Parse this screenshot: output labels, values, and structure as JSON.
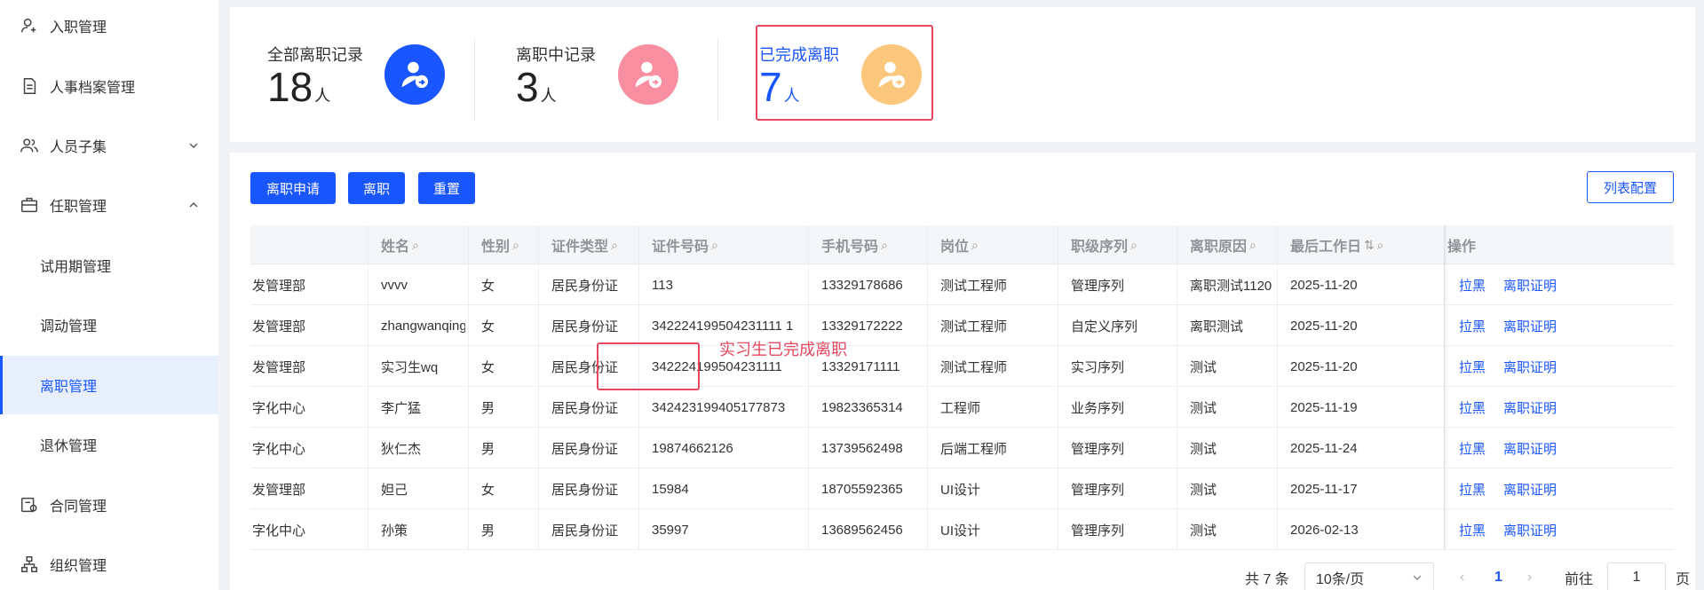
{
  "sidebar": {
    "items": [
      {
        "label": "入职管理",
        "icon": "user-add-icon"
      },
      {
        "label": "人事档案管理",
        "icon": "document-icon"
      },
      {
        "label": "人员子集",
        "icon": "users-icon"
      },
      {
        "label": "任职管理",
        "icon": "briefcase-icon"
      }
    ],
    "sub_items": [
      {
        "label": "试用期管理"
      },
      {
        "label": "调动管理"
      },
      {
        "label": "离职管理",
        "active": true
      },
      {
        "label": "退休管理"
      }
    ],
    "bottom_items": [
      {
        "label": "合同管理",
        "icon": "contract-icon"
      },
      {
        "label": "组织管理",
        "icon": "org-chart-icon"
      }
    ]
  },
  "stats": [
    {
      "title": "全部离职记录",
      "value": "18",
      "unit": "人",
      "color": "#1a56ff"
    },
    {
      "title": "离职中记录",
      "value": "3",
      "unit": "人",
      "color": "#f78fa0"
    },
    {
      "title": "已完成离职",
      "value": "7",
      "unit": "人",
      "color": "#fbc77c"
    }
  ],
  "toolbar": {
    "apply": "离职申请",
    "resign": "离职",
    "reset": "重置",
    "config": "列表配置"
  },
  "table": {
    "headers": [
      "姓名",
      "性别",
      "证件类型",
      "证件号码",
      "手机号码",
      "岗位",
      "职级序列",
      "离职原因",
      "最后工作日",
      "操作"
    ],
    "rows": [
      {
        "dept": "发管理部",
        "name": "vvvv",
        "gender": "女",
        "idtype": "居民身份证",
        "idno": "113",
        "phone": "13329178686",
        "post": "测试工程师",
        "rank": "管理序列",
        "reason": "离职测试1120",
        "lastday": "2025-11-20"
      },
      {
        "dept": "发管理部",
        "name": "zhangwanqing",
        "gender": "女",
        "idtype": "居民身份证",
        "idno": "342224199504231111 1",
        "phone": "13329172222",
        "post": "测试工程师",
        "rank": "自定义序列",
        "reason": "离职测试",
        "lastday": "2025-11-20"
      },
      {
        "dept": "发管理部",
        "name": "实习生wq",
        "gender": "女",
        "idtype": "居民身份证",
        "idno": "342224199504231111",
        "phone": "13329171111",
        "post": "测试工程师",
        "rank": "实习序列",
        "reason": "测试",
        "lastday": "2025-11-20"
      },
      {
        "dept": "字化中心",
        "name": "李广猛",
        "gender": "男",
        "idtype": "居民身份证",
        "idno": "342423199405177873",
        "phone": "19823365314",
        "post": "工程师",
        "rank": "业务序列",
        "reason": "测试",
        "lastday": "2025-11-19"
      },
      {
        "dept": "字化中心",
        "name": "狄仁杰",
        "gender": "男",
        "idtype": "居民身份证",
        "idno": "19874662126",
        "phone": "13739562498",
        "post": "后端工程师",
        "rank": "管理序列",
        "reason": "测试",
        "lastday": "2025-11-24"
      },
      {
        "dept": "发管理部",
        "name": "妲己",
        "gender": "女",
        "idtype": "居民身份证",
        "idno": "15984",
        "phone": "18705592365",
        "post": "UI设计",
        "rank": "管理序列",
        "reason": "测试",
        "lastday": "2025-11-17"
      },
      {
        "dept": "字化中心",
        "name": "孙策",
        "gender": "男",
        "idtype": "居民身份证",
        "idno": "35997",
        "phone": "13689562456",
        "post": "UI设计",
        "rank": "管理序列",
        "reason": "测试",
        "lastday": "2026-02-13"
      }
    ],
    "actions": {
      "blacklist": "拉黑",
      "certificate": "离职证明"
    }
  },
  "annotation": "实习生已完成离职",
  "pager": {
    "total": "共 7 条",
    "page_size": "10条/页",
    "current": "1",
    "goto_label": "前往",
    "goto_value": "1",
    "page_suffix": "页"
  }
}
